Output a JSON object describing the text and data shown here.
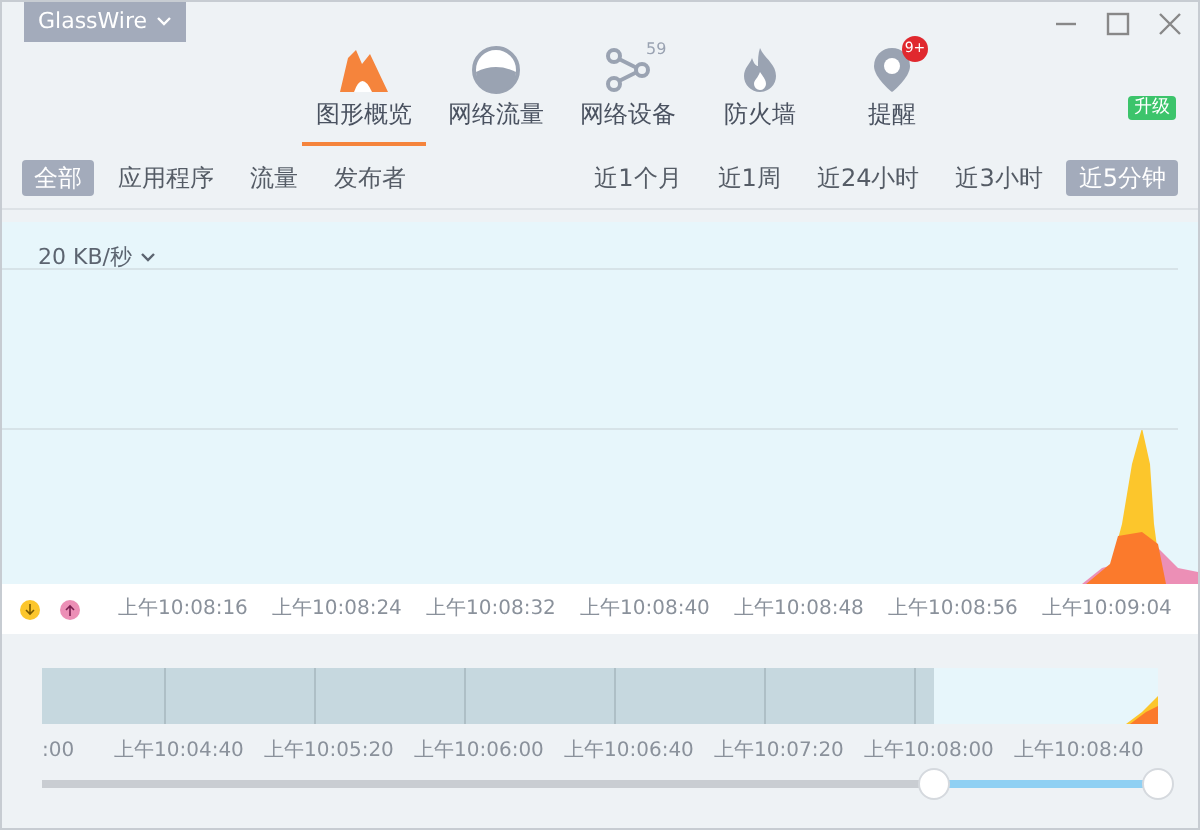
{
  "app_menu": {
    "label": "GlassWire"
  },
  "nav_tabs": [
    {
      "kind": "graph",
      "label": "图形概览",
      "selected": true
    },
    {
      "kind": "usage",
      "label": "网络流量",
      "selected": false
    },
    {
      "kind": "things",
      "label": "网络设备",
      "selected": false,
      "count": "59"
    },
    {
      "kind": "firewall",
      "label": "防火墙",
      "selected": false
    },
    {
      "kind": "alerts",
      "label": "提醒",
      "selected": false,
      "badge": "9+"
    }
  ],
  "upgrade_button": "升级",
  "filters": [
    {
      "label": "全部",
      "selected": true
    },
    {
      "label": "应用程序",
      "selected": false
    },
    {
      "label": "流量",
      "selected": false
    },
    {
      "label": "发布者",
      "selected": false
    }
  ],
  "ranges": [
    {
      "label": "近1个月",
      "selected": false
    },
    {
      "label": "近1周",
      "selected": false
    },
    {
      "label": "近24小时",
      "selected": false
    },
    {
      "label": "近3小时",
      "selected": false
    },
    {
      "label": "近5分钟",
      "selected": true
    }
  ],
  "graph": {
    "scale": "20 KB/秒"
  },
  "time_axis": [
    "上午10:08:16",
    "上午10:08:24",
    "上午10:08:32",
    "上午10:08:40",
    "上午10:08:48",
    "上午10:08:56",
    "上午10:09:04"
  ],
  "overview_axis": [
    ":00",
    "上午10:04:40",
    "上午10:05:20",
    "上午10:06:00",
    "上午10:06:40",
    "上午10:07:20",
    "上午10:08:00",
    "上午10:08:40"
  ]
}
